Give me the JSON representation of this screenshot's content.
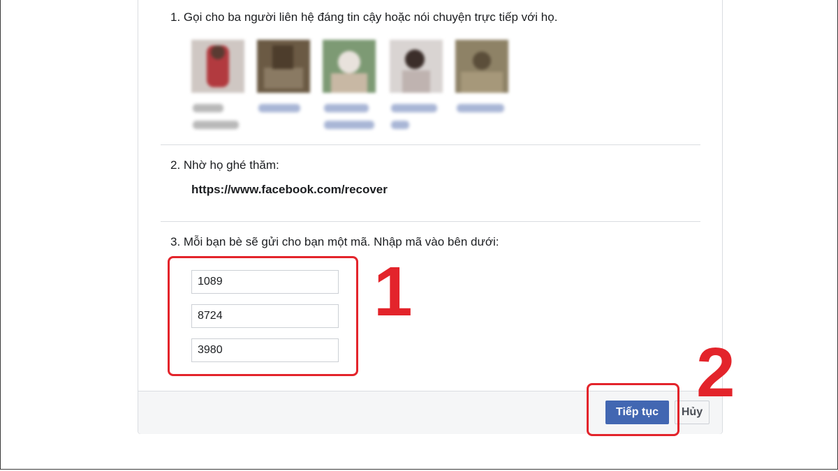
{
  "steps": {
    "step1_text": "1. Gọi cho ba người liên hệ đáng tin cậy hoặc nói chuyện trực tiếp với họ.",
    "step2_text": "2. Nhờ họ ghé thăm:",
    "recover_url": "https://www.facebook.com/recover",
    "step3_text": "3. Mỗi bạn bè sẽ gửi cho bạn một mã. Nhập mã vào bên dưới:"
  },
  "codes": [
    "1089",
    "8724",
    "3980"
  ],
  "footer": {
    "continue_label": "Tiếp tục",
    "cancel_label": "Hủy"
  },
  "annotations": {
    "marker1": "1",
    "marker2": "2"
  },
  "colors": {
    "primary_button": "#4267b2",
    "annotation_red": "#e3242b",
    "divider": "#dadde1"
  }
}
